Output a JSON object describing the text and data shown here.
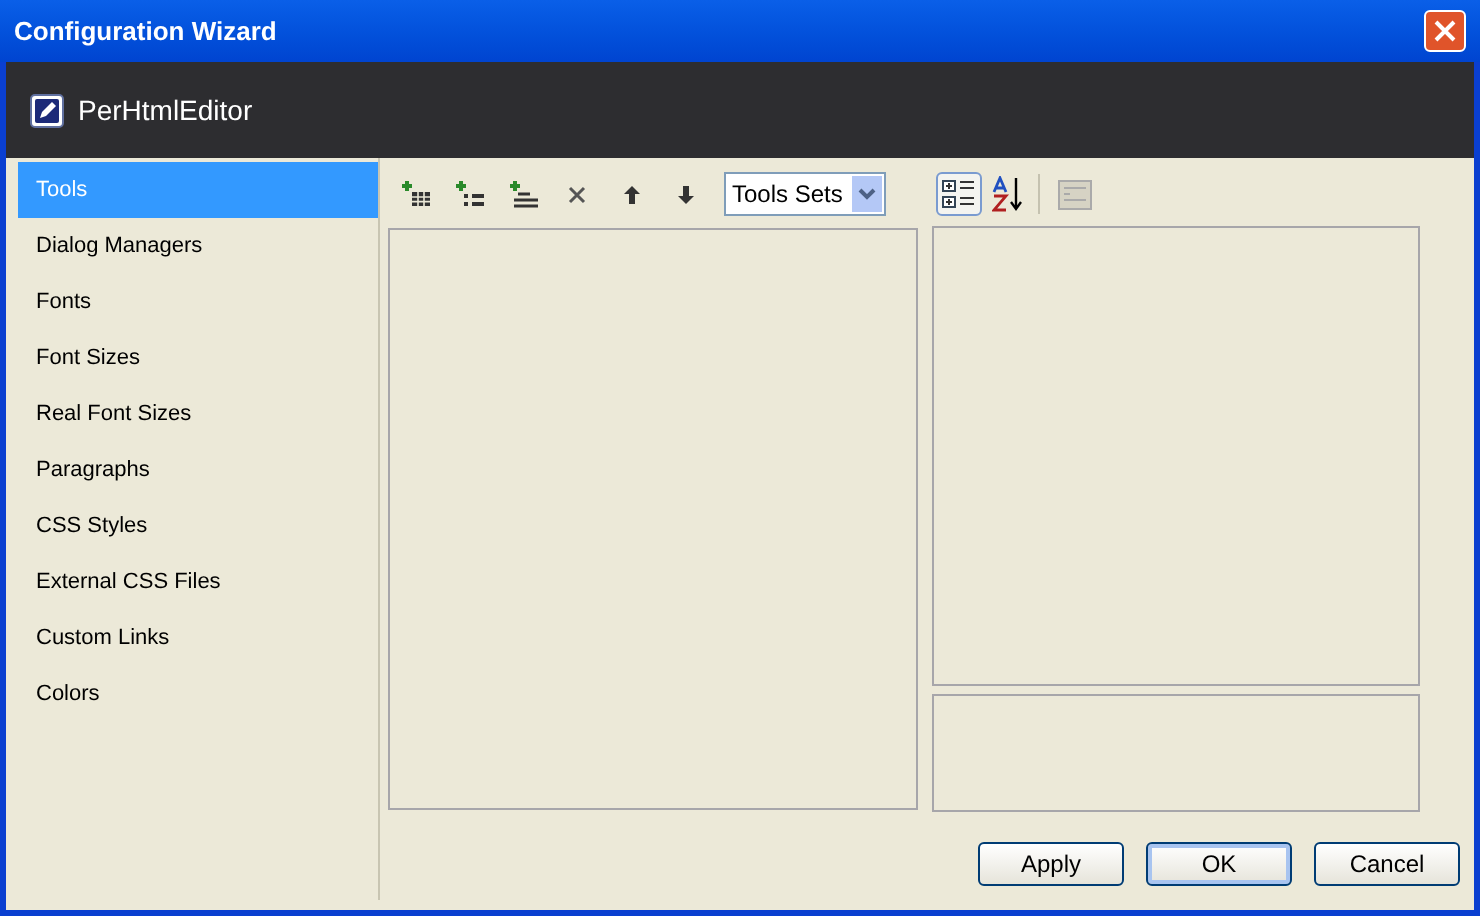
{
  "window": {
    "title": "Configuration Wizard"
  },
  "header": {
    "title": "PerHtmlEditor"
  },
  "sidebar": {
    "items": [
      {
        "label": "Tools",
        "selected": true
      },
      {
        "label": "Dialog Managers",
        "selected": false
      },
      {
        "label": "Fonts",
        "selected": false
      },
      {
        "label": "Font Sizes",
        "selected": false
      },
      {
        "label": "Real Font Sizes",
        "selected": false
      },
      {
        "label": "Paragraphs",
        "selected": false
      },
      {
        "label": "CSS Styles",
        "selected": false
      },
      {
        "label": "External CSS Files",
        "selected": false
      },
      {
        "label": "Custom Links",
        "selected": false
      },
      {
        "label": "Colors",
        "selected": false
      }
    ]
  },
  "toolbar": {
    "tool_set": {
      "value": "Tools Sets"
    },
    "view_buttons": [
      {
        "kind": "categorized",
        "selected": true
      },
      {
        "kind": "alphabetical",
        "selected": false
      }
    ],
    "property_pages": {
      "disabled": true
    }
  },
  "buttons": [
    {
      "label": "Apply",
      "default": false
    },
    {
      "label": "OK",
      "default": true
    },
    {
      "label": "Cancel",
      "default": false
    }
  ]
}
